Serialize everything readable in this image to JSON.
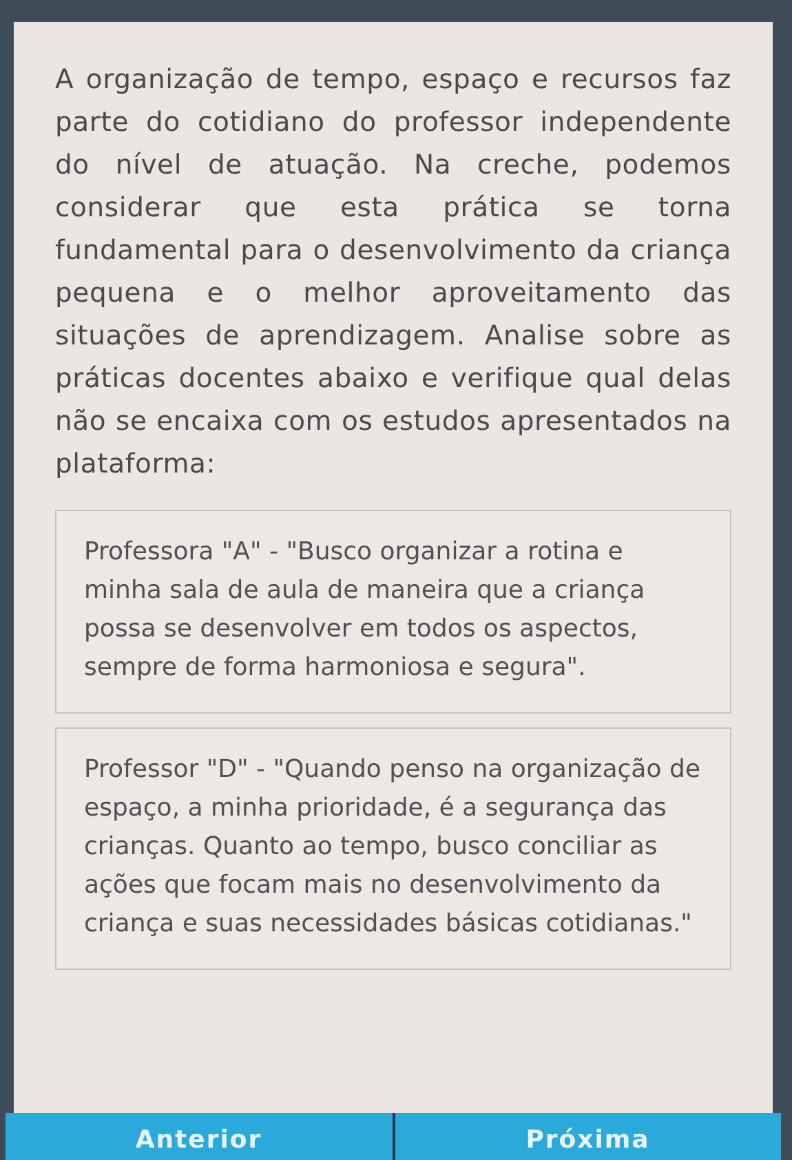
{
  "question": "A organização de tempo, espaço e recursos faz parte do cotidiano do professor independente do nível de atuação. Na creche, podemos considerar que esta prática se torna fundamental para o desenvolvimento da criança pequena e o melhor aproveitamento das situações de aprendizagem. Analise sobre as práticas docentes abaixo e verifique qual delas não se encaixa com os estudos apresentados na plataforma:",
  "options": [
    {
      "text": "Professora \"A\" - \"Busco organizar a rotina e minha sala de aula de maneira que a criança possa se desenvolver em todos os aspectos, sempre de forma harmoniosa e segura\"."
    },
    {
      "text": "Professor \"D\" - \"Quando penso na organização de espaço, a minha prioridade, é a segurança das crianças. Quanto ao tempo, busco conciliar as ações que focam mais no desenvolvimento da criança e suas necessidades básicas cotidianas.\""
    }
  ],
  "buttons": [
    "Anterior",
    "Próxima"
  ]
}
